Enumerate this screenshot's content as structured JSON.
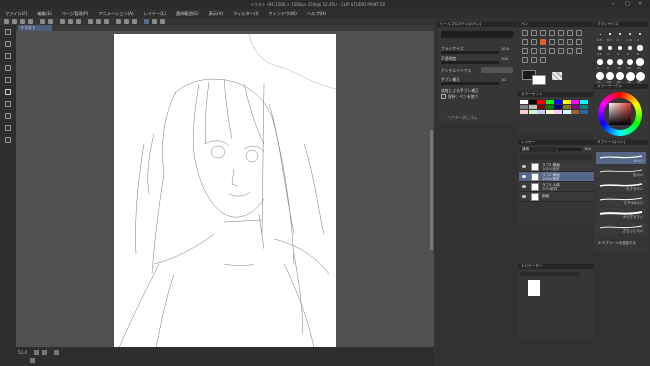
{
  "window": {
    "title": "イラスト (94.1580 × 1580px 350dpi 52.4%) - CLIP STUDIO PAINT EX"
  },
  "menu": {
    "items": [
      "ファイル(F)",
      "編集(E)",
      "ページ管理(P)",
      "アニメーション(A)",
      "レイヤー(L)",
      "選択範囲(S)",
      "表示(V)",
      "フィルター(I)",
      "ウィンドウ(W)",
      "ヘルプ(H)"
    ]
  },
  "document": {
    "tab_label": "イラスト"
  },
  "tool_property": {
    "header": "ツールプロパティ[Gペン]",
    "brush_size_label": "ブラシサイズ",
    "brush_size_value": "10.0",
    "opacity_label": "不透明度",
    "opacity_value": "100",
    "antialias_label": "アンチエイリアス",
    "stabilize_label": "手ブレ補正",
    "stabilize_value": "10",
    "speed_label": "速度による手ブレ補正",
    "checkbox_label": "保持：ペンを使う",
    "sub_header": "ベクター消しゴム"
  },
  "brush_size": {
    "header": "ブラシサイズ",
    "sizes": [
      "0.5",
      "0.7",
      "1",
      "1.5",
      "2",
      "2.5",
      "3",
      "4",
      "5",
      "6",
      "7",
      "8",
      "10",
      "12",
      "15",
      "17",
      "20",
      "25",
      "30",
      "40"
    ]
  },
  "color_set": {
    "header": "カラーセット"
  },
  "color_wheel": {
    "header": "カラーサークル"
  },
  "layer_panel": {
    "header": "レイヤー",
    "blend_mode": "通常",
    "opacity": "100",
    "layers": [
      {
        "name": "ラフ2 線画",
        "sub": "100%通常"
      },
      {
        "name": "ラフ2 線画",
        "sub": "100%通常"
      },
      {
        "name": "ラフ1 人体",
        "sub": "50%乗算"
      },
      {
        "name": "用紙",
        "sub": ""
      }
    ]
  },
  "subtool": {
    "header": "サブツール[ペン]",
    "group": "ペン",
    "items": [
      "Gペン",
      "丸ペン",
      "カブラペン",
      "リアルGペン",
      "カリグラフィ",
      "さらっとペン"
    ],
    "add_label": "サブツールを追加する"
  },
  "navigator": {
    "header": "ナビゲーター"
  },
  "status": {
    "zoom": "52.4"
  },
  "colors": {
    "main": "#1a1a1a",
    "sub": "#ffffff",
    "accent_tool": "#e8602c",
    "selection": "#556688"
  }
}
